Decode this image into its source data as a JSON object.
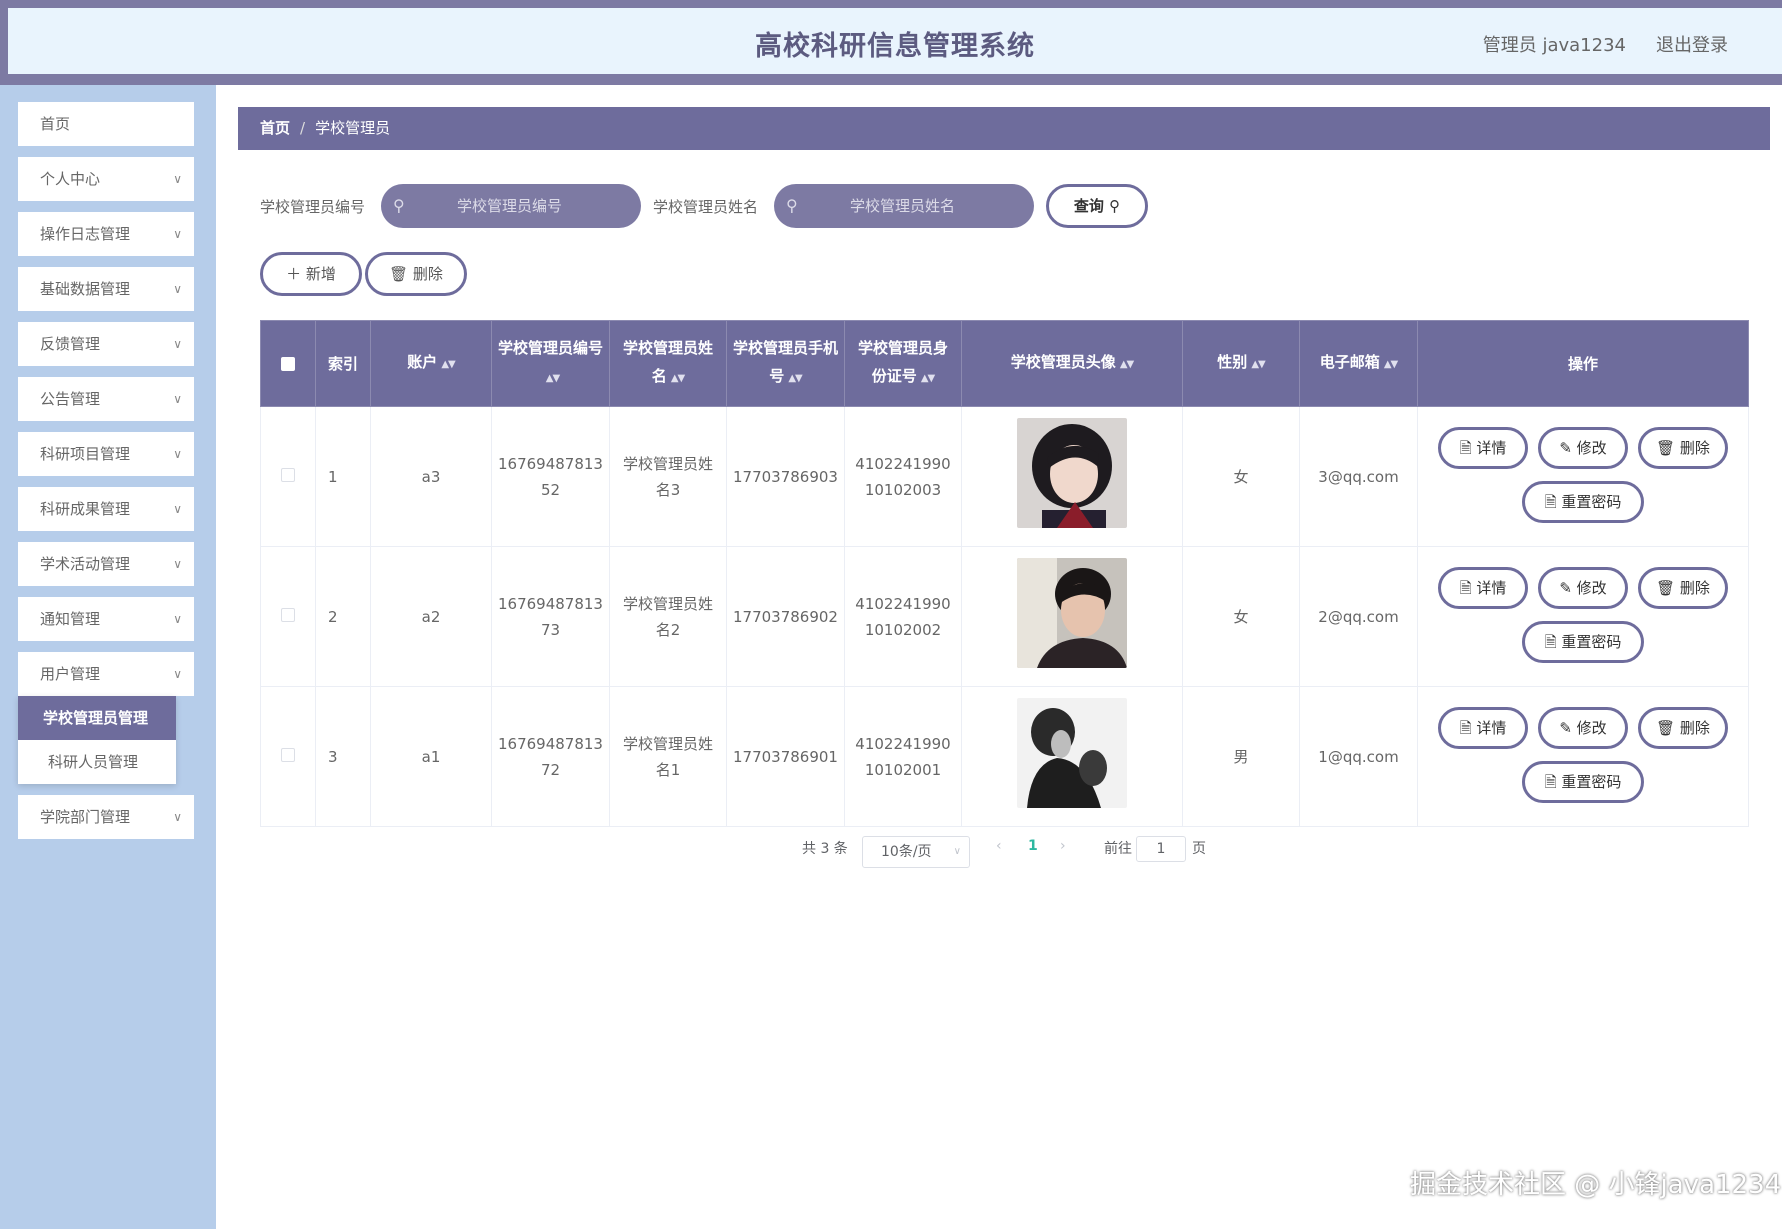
{
  "header": {
    "title": "高校科研信息管理系统",
    "user": "管理员 java1234",
    "logout": "退出登录"
  },
  "sidebar": {
    "items": [
      {
        "label": "首页"
      },
      {
        "label": "个人中心"
      },
      {
        "label": "操作日志管理"
      },
      {
        "label": "基础数据管理"
      },
      {
        "label": "反馈管理"
      },
      {
        "label": "公告管理"
      },
      {
        "label": "科研项目管理"
      },
      {
        "label": "科研成果管理"
      },
      {
        "label": "学术活动管理"
      },
      {
        "label": "通知管理"
      },
      {
        "label": "用户管理"
      },
      {
        "label": "学院部门管理"
      }
    ],
    "submenu": [
      {
        "label": "学校管理员管理"
      },
      {
        "label": "科研人员管理"
      }
    ]
  },
  "breadcrumb": {
    "home": "首页",
    "separator": "/",
    "current": "学校管理员"
  },
  "search": {
    "id_label": "学校管理员编号",
    "id_placeholder": "学校管理员编号",
    "name_label": "学校管理员姓名",
    "name_placeholder": "学校管理员姓名",
    "query": "查询"
  },
  "actions": {
    "add": "新增",
    "delete": "删除"
  },
  "table": {
    "headers": {
      "index": "索引",
      "account": "账户",
      "admin_no": "学校管理员编号",
      "admin_name": "学校管理员姓名",
      "phone": "学校管理员手机号",
      "id_card": "学校管理员身份证号",
      "avatar": "学校管理员头像",
      "gender": "性别",
      "email": "电子邮箱",
      "ops": "操作"
    },
    "rows": [
      {
        "index": "1",
        "account": "a3",
        "admin_no": "1676948781352",
        "admin_name": "学校管理员姓名3",
        "phone": "17703786903",
        "id_card": "410224199010102003",
        "gender": "女",
        "email": "3@qq.com"
      },
      {
        "index": "2",
        "account": "a2",
        "admin_no": "1676948781373",
        "admin_name": "学校管理员姓名2",
        "phone": "17703786902",
        "id_card": "410224199010102002",
        "gender": "女",
        "email": "2@qq.com"
      },
      {
        "index": "3",
        "account": "a1",
        "admin_no": "1676948781372",
        "admin_name": "学校管理员姓名1",
        "phone": "17703786901",
        "id_card": "410224199010102001",
        "gender": "男",
        "email": "1@qq.com"
      }
    ],
    "row_actions": {
      "detail": "详情",
      "edit": "修改",
      "delete": "删除",
      "reset": "重置密码"
    }
  },
  "pagination": {
    "total": "共 3 条",
    "page_size": "10条/页",
    "current_page": "1",
    "goto_label": "前往",
    "goto_value": "1",
    "page_unit": "页"
  },
  "watermark": "掘金技术社区 @ 小锋java1234",
  "colors": {
    "primary": "#6e6c9c",
    "header_band": "#7d7aa3",
    "header_bg": "#e9f4fd",
    "sidebar_bg": "#b6cdea"
  }
}
